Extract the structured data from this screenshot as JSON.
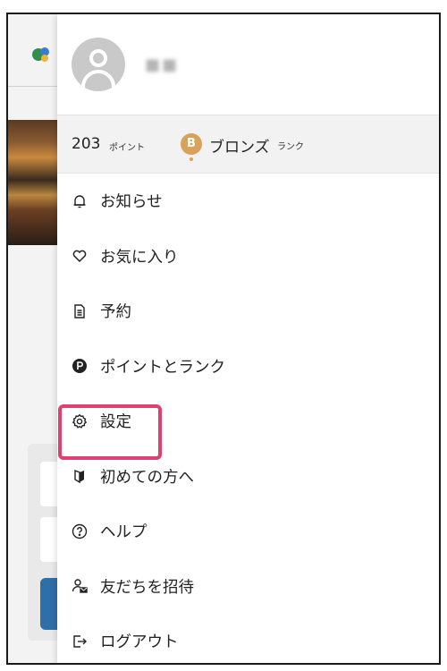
{
  "profile": {
    "username": "■■"
  },
  "points": {
    "value": "203",
    "unit": "ポイント"
  },
  "rank": {
    "badge_letter": "B",
    "name": "ブロンズ",
    "unit": "ランク"
  },
  "menu": [
    {
      "label": "お知らせ",
      "icon": "bell-icon"
    },
    {
      "label": "お気に入り",
      "icon": "heart-icon"
    },
    {
      "label": "予約",
      "icon": "document-icon"
    },
    {
      "label": "ポイントとランク",
      "icon": "points-icon"
    },
    {
      "label": "設定",
      "icon": "gear-icon"
    },
    {
      "label": "初めての方へ",
      "icon": "beginner-mark-icon"
    },
    {
      "label": "ヘルプ",
      "icon": "help-icon"
    },
    {
      "label": "友だちを招待",
      "icon": "invite-friend-icon"
    },
    {
      "label": "ログアウト",
      "icon": "logout-icon"
    }
  ],
  "colors": {
    "highlight": "#e0406f",
    "rank_bronze": "#d9a25a",
    "accent_button": "#2f6fa8"
  }
}
